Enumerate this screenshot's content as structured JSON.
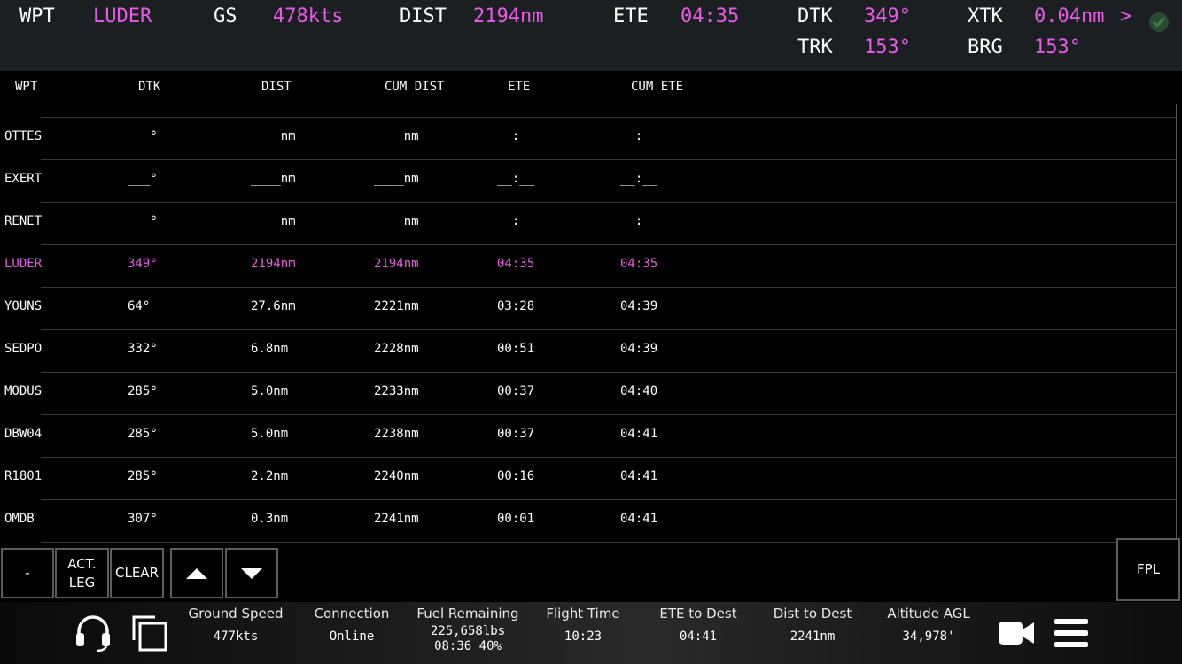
{
  "top": {
    "wpt_label": "WPT",
    "wpt_value": "LUDER",
    "gs_label": "GS",
    "gs_value": "478kts",
    "dist_label": "DIST",
    "dist_value": "2194nm",
    "ete_label": "ETE",
    "ete_value": "04:35",
    "dtk_label": "DTK",
    "dtk_value": "349°",
    "xtk_label": "XTK",
    "xtk_value": "0.04nm",
    "xtk_arrow": ">",
    "trk_label": "TRK",
    "trk_value": "153°",
    "brg_label": "BRG",
    "brg_value": "153°",
    "status_icon": "check-circle-icon"
  },
  "table": {
    "headers": [
      "WPT",
      "DTK",
      "DIST",
      "CUM DIST",
      "ETE",
      "CUM ETE"
    ],
    "rows": [
      [
        "OTTES",
        "___°",
        "____nm",
        "____nm",
        "__:__",
        "__:__"
      ],
      [
        "EXERT",
        "___°",
        "____nm",
        "____nm",
        "__:__",
        "__:__"
      ],
      [
        "RENET",
        "___°",
        "____nm",
        "____nm",
        "__:__",
        "__:__"
      ],
      [
        "LUDER",
        "349°",
        "2194nm",
        "2194nm",
        "04:35",
        "04:35"
      ],
      [
        "YOUNS",
        "64°",
        "27.6nm",
        "2221nm",
        "03:28",
        "04:39"
      ],
      [
        "SEDPO",
        "332°",
        "6.8nm",
        "2228nm",
        "00:51",
        "04:39"
      ],
      [
        "MODUS",
        "285°",
        "5.0nm",
        "2233nm",
        "00:37",
        "04:40"
      ],
      [
        "DBW04",
        "285°",
        "5.0nm",
        "2238nm",
        "00:37",
        "04:41"
      ],
      [
        "R1801",
        "285°",
        "2.2nm",
        "2240nm",
        "00:16",
        "04:41"
      ],
      [
        "OMDB",
        "307°",
        "0.3nm",
        "2241nm",
        "00:01",
        "04:41"
      ]
    ],
    "active_row": 3
  },
  "buttons": {
    "minus": "-",
    "act_leg_line1": "ACT.",
    "act_leg_line2": "LEG",
    "clear": "CLEAR",
    "up_icon": "caret-up-icon",
    "down_icon": "caret-down-icon",
    "fpl": "FPL"
  },
  "status": {
    "ground_speed_label": "Ground Speed",
    "ground_speed_value": "477kts",
    "connection_label": "Connection",
    "connection_value": "Online",
    "fuel_label": "Fuel Remaining",
    "fuel_value_line1": "225,658lbs",
    "fuel_value_line2": "08:36 40%",
    "flight_time_label": "Flight Time",
    "flight_time_value": "10:23",
    "ete_dest_label": "ETE to Dest",
    "ete_dest_value": "04:41",
    "dist_dest_label": "Dist to Dest",
    "dist_dest_value": "2241nm",
    "alt_label": "Altitude AGL",
    "alt_value": "34,978'"
  },
  "colors": {
    "magenta": "#e85ae6",
    "background": "#000000",
    "topbar": "#1b1f21"
  }
}
